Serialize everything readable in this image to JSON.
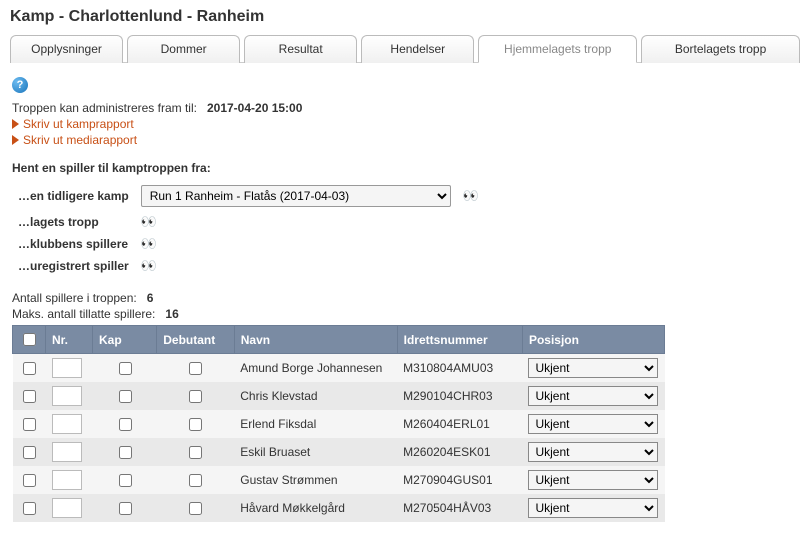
{
  "pageTitle": "Kamp - Charlottenlund - Ranheim",
  "tabs": [
    {
      "label": "Opplysninger"
    },
    {
      "label": "Dommer"
    },
    {
      "label": "Resultat"
    },
    {
      "label": "Hendelser"
    },
    {
      "label": "Hjemmelagets tropp",
      "active": true
    },
    {
      "label": "Bortelagets tropp"
    }
  ],
  "adminLine": {
    "text": "Troppen kan administreres fram til:",
    "deadline": "2017-04-20 15:00"
  },
  "links": {
    "report": "Skriv ut kamprapport",
    "media": "Skriv ut mediarapport"
  },
  "fetch": {
    "heading": "Hent en spiller til kamptroppen fra:",
    "rows": {
      "prevmatch": "…en tidligere kamp",
      "teamsquad": "…lagets tropp",
      "clubplayers": "…klubbens spillere",
      "unregistered": "…uregistrert spiller"
    },
    "prevMatchOption": "Run 1 Ranheim - Flatås (2017-04-03)"
  },
  "counts": {
    "countLabel": "Antall spillere i troppen:",
    "countValue": "6",
    "maxLabel": "Maks. antall tillatte spillere:",
    "maxValue": "16"
  },
  "table": {
    "headers": {
      "nr": "Nr.",
      "kap": "Kap",
      "debut": "Debutant",
      "name": "Navn",
      "id": "Idrettsnummer",
      "pos": "Posisjon"
    },
    "posOption": "Ukjent",
    "players": [
      {
        "name": "Amund Borge Johannesen",
        "id": "M310804AMU03"
      },
      {
        "name": "Chris Klevstad",
        "id": "M290104CHR03"
      },
      {
        "name": "Erlend Fiksdal",
        "id": "M260404ERL01"
      },
      {
        "name": "Eskil Bruaset",
        "id": "M260204ESK01"
      },
      {
        "name": "Gustav Strømmen",
        "id": "M270904GUS01"
      },
      {
        "name": "Håvard Møkkelgård",
        "id": "M270504HÅV03"
      }
    ]
  }
}
